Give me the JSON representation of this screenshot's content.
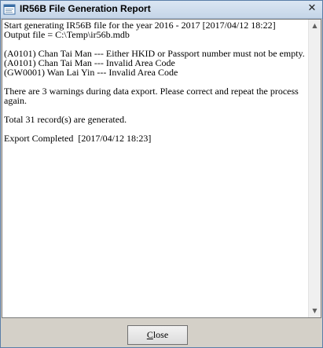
{
  "window": {
    "title": "IR56B File Generation Report",
    "icon": "app-window-icon",
    "close_glyph": "✕"
  },
  "report": {
    "lines": [
      "Start generating IR56B file for the year 2016 - 2017 [2017/04/12 18:22]",
      "Output file = C:\\Temp\\ir56b.mdb",
      "",
      "(A0101) Chan Tai Man --- Either HKID or Passport number must not be empty.",
      "(A0101) Chan Tai Man --- Invalid Area Code",
      "(GW0001) Wan Lai Yin --- Invalid Area Code",
      "",
      "There are 3 warnings during data export. Please correct and repeat the process",
      "again.",
      "",
      "Total 31 record(s) are generated.",
      "",
      "Export Completed  [2017/04/12 18:23]"
    ]
  },
  "scrollbar": {
    "up_glyph": "▲",
    "down_glyph": "▼"
  },
  "footer": {
    "close_label_first": "C",
    "close_label_rest": "lose"
  }
}
